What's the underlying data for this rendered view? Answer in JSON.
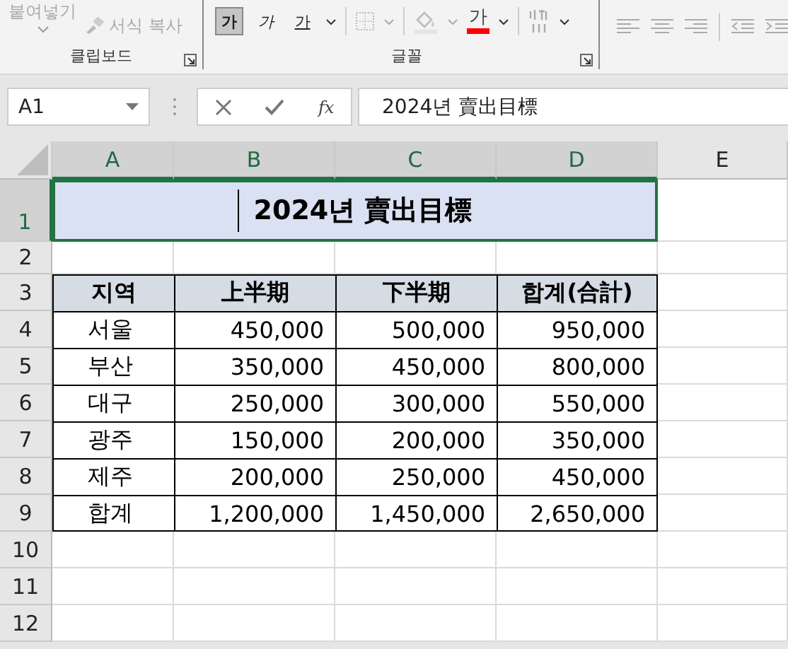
{
  "ribbon": {
    "clipboard": {
      "paste_label": "붙여넣기",
      "format_painter": "서식 복사",
      "group_label": "클립보드"
    },
    "font": {
      "bold": {
        "label": "가",
        "selected": true
      },
      "italic": "가",
      "underline": "가",
      "font_color_label": "가",
      "group_label": "글꼴"
    }
  },
  "formula_bar": {
    "name_box": "A1",
    "fx": "fx",
    "value": "2024년 賣出目標"
  },
  "columns": [
    {
      "label": "A",
      "selected": true
    },
    {
      "label": "B",
      "selected": true
    },
    {
      "label": "C",
      "selected": true
    },
    {
      "label": "D",
      "selected": true
    },
    {
      "label": "E",
      "selected": false
    }
  ],
  "rows": [
    {
      "label": "1",
      "selected": true
    },
    {
      "label": "2",
      "selected": false
    },
    {
      "label": "3",
      "selected": false
    },
    {
      "label": "4",
      "selected": false
    },
    {
      "label": "5",
      "selected": false
    },
    {
      "label": "6",
      "selected": false
    },
    {
      "label": "7",
      "selected": false
    },
    {
      "label": "8",
      "selected": false
    },
    {
      "label": "9",
      "selected": false
    },
    {
      "label": "10",
      "selected": false
    },
    {
      "label": "11",
      "selected": false
    },
    {
      "label": "12",
      "selected": false
    }
  ],
  "title": "2024년 賣出目標",
  "table": {
    "header": [
      "지역",
      "上半期",
      "下半期",
      "합계(合計)"
    ],
    "rows": [
      [
        "서울",
        "450,000",
        "500,000",
        "950,000"
      ],
      [
        "부산",
        "350,000",
        "450,000",
        "800,000"
      ],
      [
        "대구",
        "250,000",
        "300,000",
        "550,000"
      ],
      [
        "광주",
        "150,000",
        "200,000",
        "350,000"
      ],
      [
        "제주",
        "200,000",
        "250,000",
        "450,000"
      ],
      [
        "합계",
        "1,200,000",
        "1,450,000",
        "2,650,000"
      ]
    ]
  }
}
